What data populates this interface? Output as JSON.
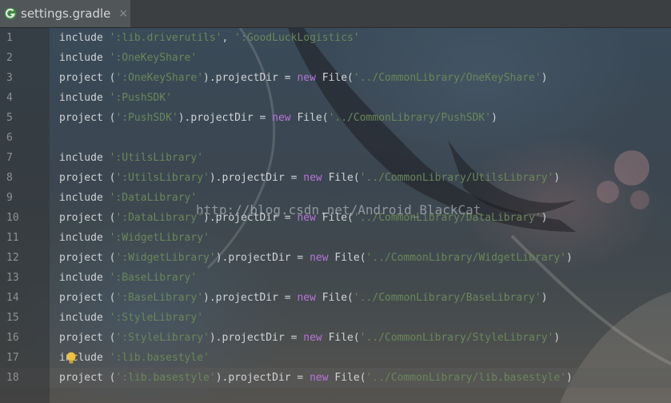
{
  "tab": {
    "filename": "settings.gradle",
    "close_glyph": "×",
    "icon": "gradle-icon"
  },
  "watermark": "http://blog.csdn.net/Android_BlackCat",
  "colors": {
    "string": "#6a8759",
    "keyword": "#b774d8",
    "plain": "#cfd3d6",
    "line_number": "#8c9195"
  },
  "gutter": {
    "line_numbers": [
      "1",
      "2",
      "3",
      "4",
      "5",
      "6",
      "7",
      "8",
      "9",
      "10",
      "11",
      "12",
      "13",
      "14",
      "15",
      "16",
      "17",
      "18"
    ]
  },
  "editor": {
    "lines": [
      [
        {
          "t": "include ",
          "c": "p"
        },
        {
          "t": "':lib.driverutils'",
          "c": "s"
        },
        {
          "t": ", ",
          "c": "p"
        },
        {
          "t": "':GoodLuckLogistics'",
          "c": "s"
        }
      ],
      [
        {
          "t": "include ",
          "c": "p"
        },
        {
          "t": "':OneKeyShare'",
          "c": "s"
        }
      ],
      [
        {
          "t": "project (",
          "c": "p"
        },
        {
          "t": "':OneKeyShare'",
          "c": "s"
        },
        {
          "t": ").projectDir = ",
          "c": "p"
        },
        {
          "t": "new",
          "c": "k"
        },
        {
          "t": " File(",
          "c": "p"
        },
        {
          "t": "'../CommonLibrary/OneKeyShare'",
          "c": "s"
        },
        {
          "t": ")",
          "c": "p"
        }
      ],
      [
        {
          "t": "include ",
          "c": "p"
        },
        {
          "t": "':PushSDK'",
          "c": "s"
        }
      ],
      [
        {
          "t": "project (",
          "c": "p"
        },
        {
          "t": "':PushSDK'",
          "c": "s"
        },
        {
          "t": ").projectDir = ",
          "c": "p"
        },
        {
          "t": "new",
          "c": "k"
        },
        {
          "t": " File(",
          "c": "p"
        },
        {
          "t": "'../CommonLibrary/PushSDK'",
          "c": "s"
        },
        {
          "t": ")",
          "c": "p"
        }
      ],
      [],
      [
        {
          "t": "include ",
          "c": "p"
        },
        {
          "t": "':UtilsLibrary'",
          "c": "s"
        }
      ],
      [
        {
          "t": "project (",
          "c": "p"
        },
        {
          "t": "':UtilsLibrary'",
          "c": "s"
        },
        {
          "t": ").projectDir = ",
          "c": "p"
        },
        {
          "t": "new",
          "c": "k"
        },
        {
          "t": " File(",
          "c": "p"
        },
        {
          "t": "'../CommonLibrary/UtilsLibrary'",
          "c": "s"
        },
        {
          "t": ")",
          "c": "p"
        }
      ],
      [
        {
          "t": "include ",
          "c": "p"
        },
        {
          "t": "':DataLibrary'",
          "c": "s"
        }
      ],
      [
        {
          "t": "project (",
          "c": "p"
        },
        {
          "t": "':DataLibrary'",
          "c": "s"
        },
        {
          "t": ").projectDir = ",
          "c": "p"
        },
        {
          "t": "new",
          "c": "k"
        },
        {
          "t": " File(",
          "c": "p"
        },
        {
          "t": "'../CommonLibrary/DataLibrary'",
          "c": "s"
        },
        {
          "t": ")",
          "c": "p"
        }
      ],
      [
        {
          "t": "include ",
          "c": "p"
        },
        {
          "t": "':WidgetLibrary'",
          "c": "s"
        }
      ],
      [
        {
          "t": "project (",
          "c": "p"
        },
        {
          "t": "':WidgetLibrary'",
          "c": "s"
        },
        {
          "t": ").projectDir = ",
          "c": "p"
        },
        {
          "t": "new",
          "c": "k"
        },
        {
          "t": " File(",
          "c": "p"
        },
        {
          "t": "'../CommonLibrary/WidgetLibrary'",
          "c": "s"
        },
        {
          "t": ")",
          "c": "p"
        }
      ],
      [
        {
          "t": "include ",
          "c": "p"
        },
        {
          "t": "':BaseLibrary'",
          "c": "s"
        }
      ],
      [
        {
          "t": "project (",
          "c": "p"
        },
        {
          "t": "':BaseLibrary'",
          "c": "s"
        },
        {
          "t": ").projectDir = ",
          "c": "p"
        },
        {
          "t": "new",
          "c": "k"
        },
        {
          "t": " File(",
          "c": "p"
        },
        {
          "t": "'../CommonLibrary/BaseLibrary'",
          "c": "s"
        },
        {
          "t": ")",
          "c": "p"
        }
      ],
      [
        {
          "t": "include ",
          "c": "p"
        },
        {
          "t": "':StyleLibrary'",
          "c": "s"
        }
      ],
      [
        {
          "t": "project (",
          "c": "p"
        },
        {
          "t": "':StyleLibrary'",
          "c": "s"
        },
        {
          "t": ").projectDir = ",
          "c": "p"
        },
        {
          "t": "new",
          "c": "k"
        },
        {
          "t": " File(",
          "c": "p"
        },
        {
          "t": "'../CommonLibrary/StyleLibrary'",
          "c": "s"
        },
        {
          "t": ")",
          "c": "p"
        }
      ],
      [
        {
          "t": "include ",
          "c": "p"
        },
        {
          "t": "':lib.basestyle'",
          "c": "s"
        }
      ],
      [
        {
          "t": "project (",
          "c": "p"
        },
        {
          "t": "':lib.basestyle'",
          "c": "s"
        },
        {
          "t": ").projectDir = ",
          "c": "p"
        },
        {
          "t": "new",
          "c": "k"
        },
        {
          "t": " File(",
          "c": "p"
        },
        {
          "t": "'../CommonLibrary/lib.basestyle'",
          "c": "s"
        },
        {
          "t": ")",
          "c": "p"
        }
      ]
    ]
  }
}
